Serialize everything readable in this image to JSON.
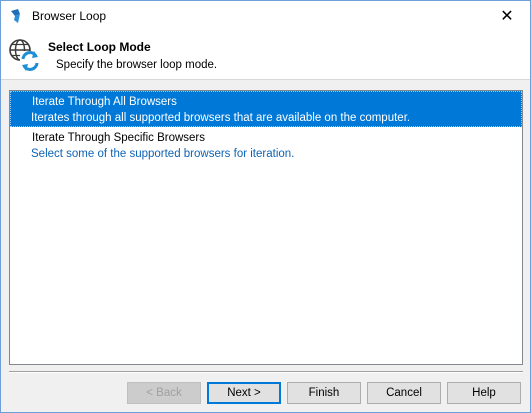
{
  "window": {
    "title": "Browser Loop",
    "close_glyph": "✕"
  },
  "header": {
    "title": "Select Loop Mode",
    "subtitle": "Specify the browser loop mode.",
    "icon": "globe-refresh-icon"
  },
  "options": [
    {
      "title": "Iterate Through All Browsers",
      "description": "Iterates through all supported browsers that are available on the computer.",
      "selected": true
    },
    {
      "title": "Iterate Through Specific Browsers",
      "description": "Select some of the supported browsers for iteration.",
      "selected": false
    }
  ],
  "buttons": {
    "back": "< Back",
    "next": "Next >",
    "finish": "Finish",
    "cancel": "Cancel",
    "help": "Help"
  },
  "colors": {
    "selection": "#0078d7",
    "link_text": "#0e63b4",
    "title_bar_border": "#6f9fd8"
  }
}
